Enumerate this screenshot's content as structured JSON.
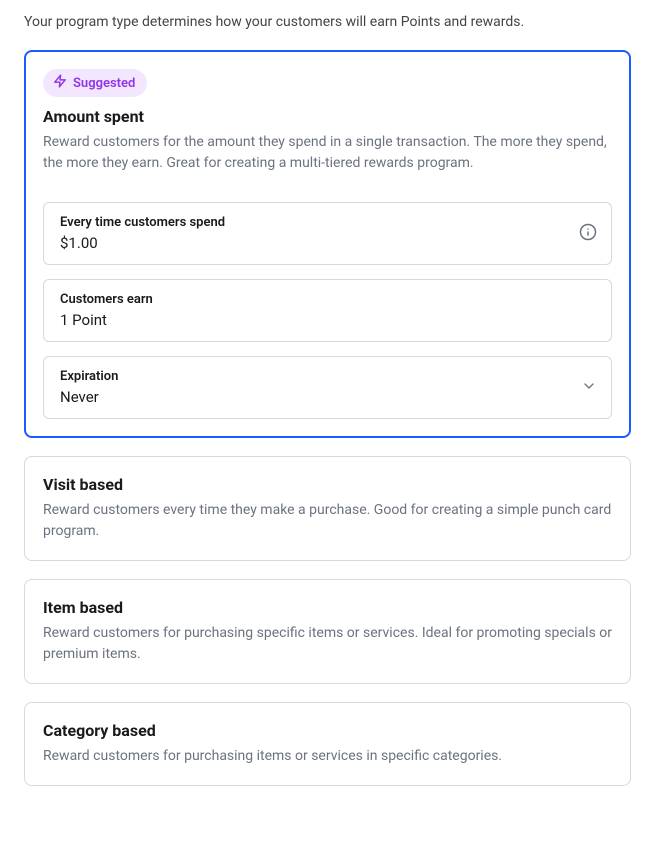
{
  "intro": "Your program type determines how your customers will earn Points and rewards.",
  "selectedCard": {
    "badge": "Suggested",
    "title": "Amount spent",
    "description": "Reward customers for the amount they spend in a single transaction. The more they spend, the more they earn. Great for creating a multi-tiered rewards program.",
    "fields": {
      "spend": {
        "label": "Every time customers spend",
        "value": "$1.00"
      },
      "earn": {
        "label": "Customers earn",
        "value": "1 Point"
      },
      "expiration": {
        "label": "Expiration",
        "value": "Never"
      }
    }
  },
  "cards": {
    "visit": {
      "title": "Visit based",
      "description": "Reward customers every time they make a purchase. Good for creating a simple punch card program."
    },
    "item": {
      "title": "Item based",
      "description": "Reward customers for purchasing specific items or services. Ideal for promoting specials or premium items."
    },
    "category": {
      "title": "Category based",
      "description": "Reward customers for purchasing items or services in specific categories."
    }
  }
}
